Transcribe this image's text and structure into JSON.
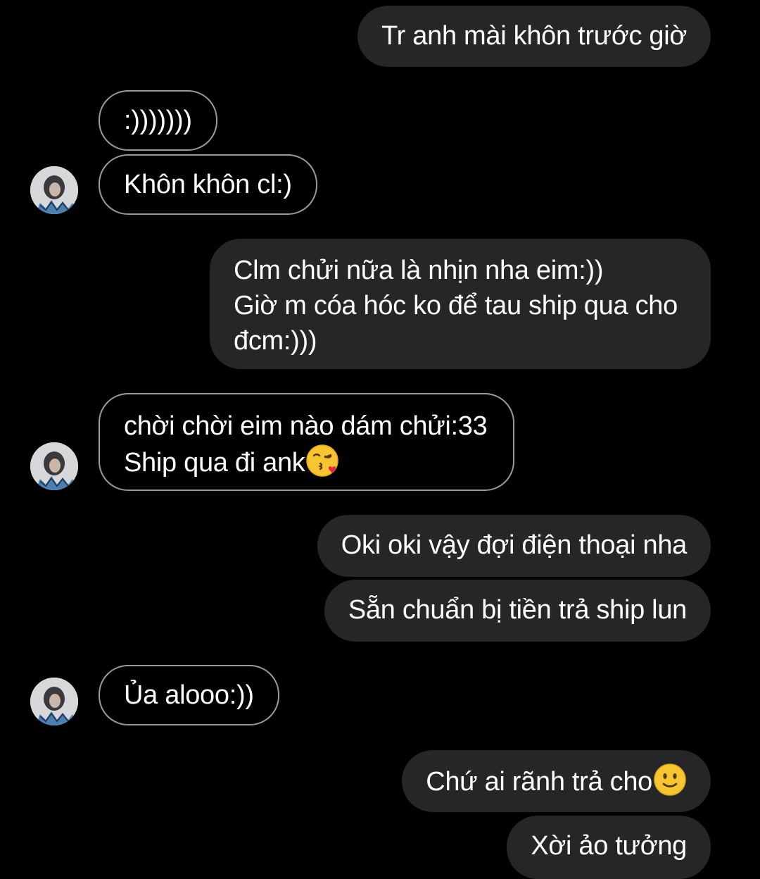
{
  "messages": [
    {
      "side": "sent",
      "lines": [
        "Tr anh mài khôn trước giờ"
      ]
    },
    {
      "side": "received",
      "lines": [
        ":)))))))"
      ]
    },
    {
      "side": "received",
      "lines": [
        "Khôn khôn cl:)"
      ]
    },
    {
      "side": "sent",
      "lines": [
        "Clm chửi nữa là nhịn nha eim:))",
        "Giờ m cóa hóc ko để tau ship qua cho",
        "đcm:)))"
      ]
    },
    {
      "side": "received",
      "lines": [
        "chời chời eim nào dám chửi:33",
        "Ship qua đi ank"
      ],
      "emoji": "face-blowing-kiss"
    },
    {
      "side": "sent",
      "lines": [
        "Oki oki vậy đợi điện thoại nha"
      ]
    },
    {
      "side": "sent",
      "lines": [
        "Sẵn chuẩn bị tiền trả ship lun"
      ]
    },
    {
      "side": "received",
      "lines": [
        "Ủa alooo:))"
      ]
    },
    {
      "side": "sent",
      "lines": [
        "Chứ ai rãnh trả cho"
      ],
      "emoji": "slightly-smiling-face"
    },
    {
      "side": "sent",
      "lines": [
        "Xời ảo tưởng"
      ]
    }
  ],
  "icons": {
    "avatar": "contact-avatar-photo",
    "kiss_emoji": "face-blowing-kiss",
    "smile_emoji": "slightly-smiling-face"
  },
  "colors": {
    "background": "#000000",
    "sent_bubble": "#262629",
    "received_border": "#9a9a9e",
    "text": "#ffffff"
  }
}
